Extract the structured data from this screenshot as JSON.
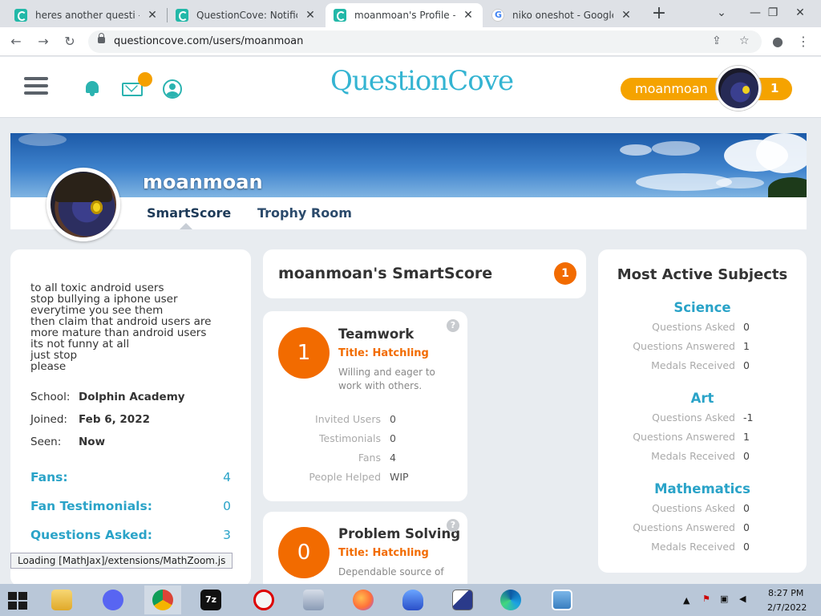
{
  "browser": {
    "tabs": [
      {
        "title": "heres another questi — Q",
        "icon": "questioncove-favicon",
        "active": false
      },
      {
        "title": "QuestionCove: Notificatio",
        "icon": "questioncove-favicon",
        "active": false
      },
      {
        "title": "moanmoan's Profile – Qu",
        "icon": "questioncove-favicon",
        "active": true
      },
      {
        "title": "niko oneshot - Google S",
        "icon": "google-favicon",
        "active": false
      }
    ],
    "new_tab": "+",
    "url": "questioncove.com/users/moanmoan"
  },
  "site_header": {
    "logo": "QuestionCove",
    "username": "moanmoan",
    "user_count": "1"
  },
  "profile": {
    "name": "moanmoan",
    "tabs": [
      "SmartScore",
      "Trophy Room"
    ],
    "bio": [
      "to all toxic android users",
      "stop bullying a iphone user",
      "everytime you see them",
      "then claim that android users are",
      "more mature than android users",
      "its not funny at all",
      "just stop",
      "please"
    ],
    "school_label": "School:",
    "school": "Dolphin Academy",
    "joined_label": "Joined:",
    "joined": "Feb 6, 2022",
    "seen_label": "Seen:",
    "seen": "Now",
    "stats": [
      {
        "label": "Fans:",
        "value": "4"
      },
      {
        "label": "Fan Testimonials:",
        "value": "0"
      },
      {
        "label": "Questions Asked:",
        "value": "3"
      }
    ]
  },
  "smartscore": {
    "title": "moanmoan's SmartScore",
    "score": "1",
    "skills": [
      {
        "level": "1",
        "name": "Teamwork",
        "title": "Title: Hatchling",
        "desc": "Willing and eager to work with others.",
        "metrics": [
          {
            "label": "Invited Users",
            "value": "0"
          },
          {
            "label": "Testimonials",
            "value": "0"
          },
          {
            "label": "Fans",
            "value": "4"
          },
          {
            "label": "People Helped",
            "value": "WIP"
          }
        ]
      },
      {
        "level": "0",
        "name": "Problem Solving",
        "title": "Title: Hatchling",
        "desc": "Dependable source of"
      }
    ]
  },
  "most_active": {
    "title": "Most Active Subjects",
    "subjects": [
      {
        "name": "Science",
        "rows": [
          {
            "label": "Questions Asked",
            "value": "0"
          },
          {
            "label": "Questions Answered",
            "value": "1"
          },
          {
            "label": "Medals Received",
            "value": "0"
          }
        ]
      },
      {
        "name": "Art",
        "rows": [
          {
            "label": "Questions Asked",
            "value": "-1"
          },
          {
            "label": "Questions Answered",
            "value": "1"
          },
          {
            "label": "Medals Received",
            "value": "0"
          }
        ]
      },
      {
        "name": "Mathematics",
        "rows": [
          {
            "label": "Questions Asked",
            "value": "0"
          },
          {
            "label": "Questions Answered",
            "value": "0"
          },
          {
            "label": "Medals Received",
            "value": "0"
          }
        ]
      }
    ]
  },
  "status_bar": "Loading [MathJax]/extensions/MathZoom.js",
  "taskbar": {
    "apps": [
      "file-explorer",
      "discord",
      "chrome",
      "7zip",
      "blocked-app",
      "network-app",
      "firefox",
      "blue-flame-app",
      "paint-app",
      "edge",
      "photos-app"
    ],
    "time": "8:27 PM",
    "date": "2/7/2022"
  },
  "colors": {
    "accent_teal": "#2bb3b0",
    "link_blue": "#2aa3c8",
    "orange": "#f26b00",
    "pill_yellow": "#f5a300"
  }
}
